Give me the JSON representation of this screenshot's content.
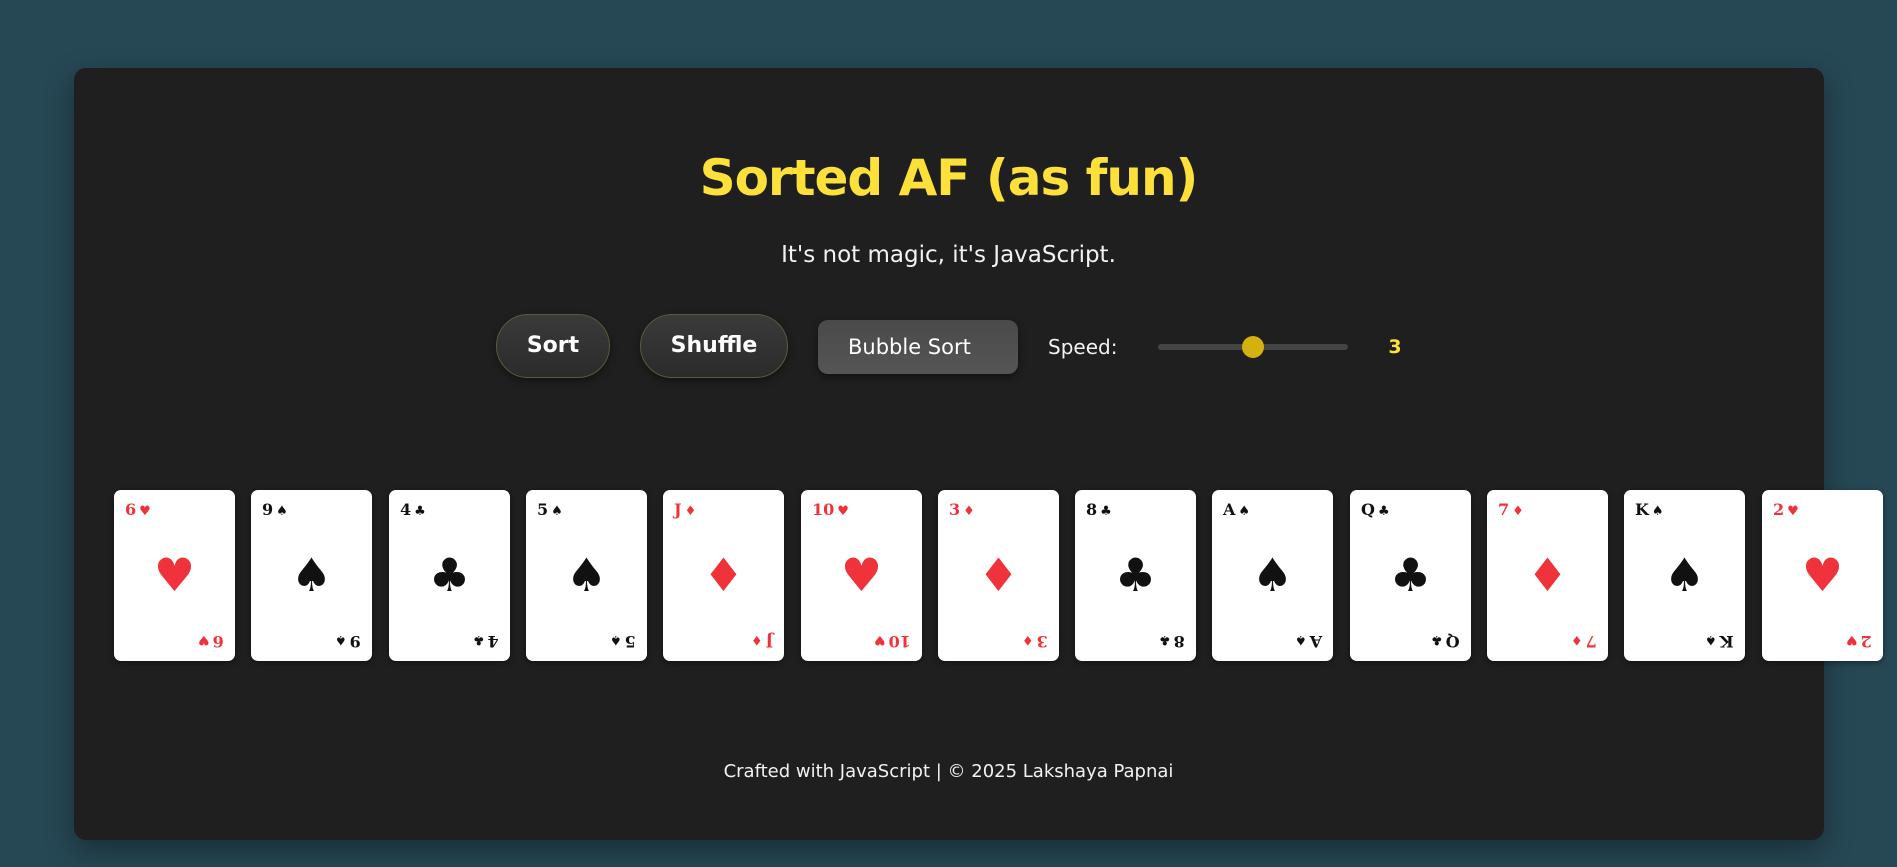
{
  "app": {
    "title": "Sorted AF (as fun)",
    "subtitle": "It's not magic, it's JavaScript."
  },
  "controls": {
    "sort_label": "Sort",
    "shuffle_label": "Shuffle",
    "algorithm_selected": "Bubble Sort",
    "speed_label": "Speed:",
    "speed_value": "3"
  },
  "cards": [
    {
      "rank": "6",
      "suit": "♥",
      "color": "red"
    },
    {
      "rank": "9",
      "suit": "♠",
      "color": "black"
    },
    {
      "rank": "4",
      "suit": "♣",
      "color": "black"
    },
    {
      "rank": "5",
      "suit": "♠",
      "color": "black"
    },
    {
      "rank": "J",
      "suit": "♦",
      "color": "red"
    },
    {
      "rank": "10",
      "suit": "♥",
      "color": "red"
    },
    {
      "rank": "3",
      "suit": "♦",
      "color": "red"
    },
    {
      "rank": "8",
      "suit": "♣",
      "color": "black"
    },
    {
      "rank": "A",
      "suit": "♠",
      "color": "black"
    },
    {
      "rank": "Q",
      "suit": "♣",
      "color": "black"
    },
    {
      "rank": "7",
      "suit": "♦",
      "color": "red"
    },
    {
      "rank": "K",
      "suit": "♠",
      "color": "black"
    },
    {
      "rank": "2",
      "suit": "♥",
      "color": "red"
    }
  ],
  "footer": {
    "text": "Crafted with JavaScript | © 2025 Lakshaya Papnai"
  },
  "colors": {
    "accent": "#fde03a",
    "background": "#264754",
    "panel": "#1f1f1f",
    "red_suit": "#f0323a"
  }
}
